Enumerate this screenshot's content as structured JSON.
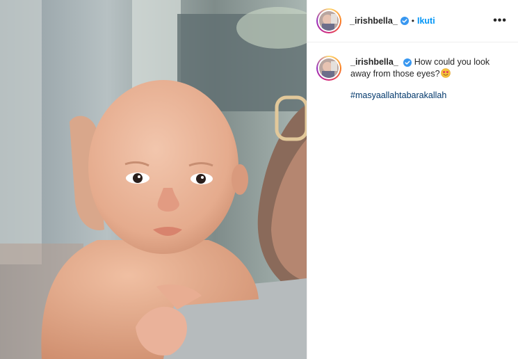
{
  "post": {
    "image_alt": "baby photo",
    "header": {
      "username": "_irishbella_",
      "separator": "•",
      "follow_label": "Ikuti",
      "more_label": "•••"
    },
    "caption": {
      "username": "_irishbella_",
      "text": "How could you look away from those eyes?",
      "emoji_icon": "smiling-face-with-heart-eyes-icon",
      "hashtag": "#masyaallahtabarakallah"
    },
    "colors": {
      "follow_blue": "#0095f6",
      "hashtag_blue": "#00376b",
      "verified_blue": "#3897f0"
    }
  }
}
